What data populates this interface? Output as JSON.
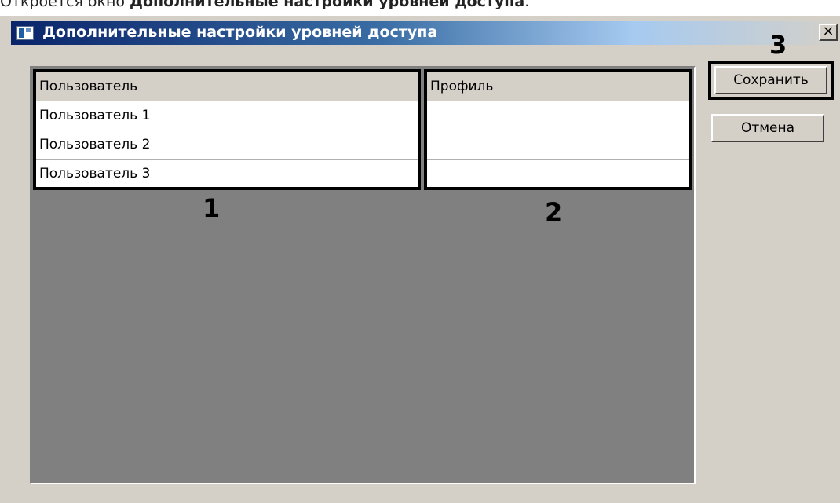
{
  "caption": {
    "prefix": "Откроется окно ",
    "bold": "Дополнительные настройки уровней доступа",
    "suffix": "."
  },
  "window": {
    "title": "Дополнительные настройки уровней доступа",
    "close_label": "×"
  },
  "grid": {
    "users": {
      "header": "Пользователь",
      "rows": [
        "Пользователь 1",
        "Пользователь 2",
        "Пользователь 3"
      ]
    },
    "profile": {
      "header": "Профиль",
      "rows": [
        "",
        "",
        ""
      ]
    }
  },
  "buttons": {
    "save_label": "Сохранить",
    "cancel_label": "Отмена"
  },
  "annotations": {
    "n1": "1",
    "n2": "2",
    "n3": "3"
  },
  "colors": {
    "dialog_bg": "#d4d0c8",
    "grid_bg": "#808080",
    "title_gradient_start": "#0a246a",
    "highlight": "#000000"
  },
  "icons": {
    "window_icon": "window-app-icon",
    "close": "close-icon"
  }
}
